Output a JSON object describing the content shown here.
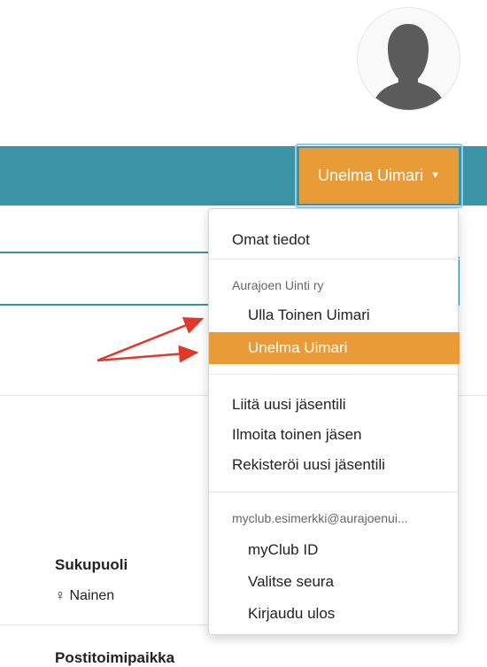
{
  "user": {
    "name": "Unelma Uimari",
    "caret": "▼"
  },
  "menu": {
    "own_info": "Omat tiedot",
    "club_header": "Aurajoen Uinti ry",
    "members": [
      "Ulla Toinen Uimari",
      "Unelma Uimari"
    ],
    "actions": [
      "Liitä uusi jäsentili",
      "Ilmoita toinen jäsen",
      "Rekisteröi uusi jäsentili"
    ],
    "account_email": "myclub.esimerkki@aurajoenui...",
    "account_items": [
      "myClub ID",
      "Valitse seura",
      "Kirjaudu ulos"
    ]
  },
  "profile": {
    "gender_label": "Sukupuoli",
    "gender_value": "♀ Nainen",
    "city_label": "Postitoimipaikka"
  },
  "colors": {
    "topbar": "#3b93a6",
    "accent": "#e89b36",
    "arrow": "#e0392b"
  }
}
